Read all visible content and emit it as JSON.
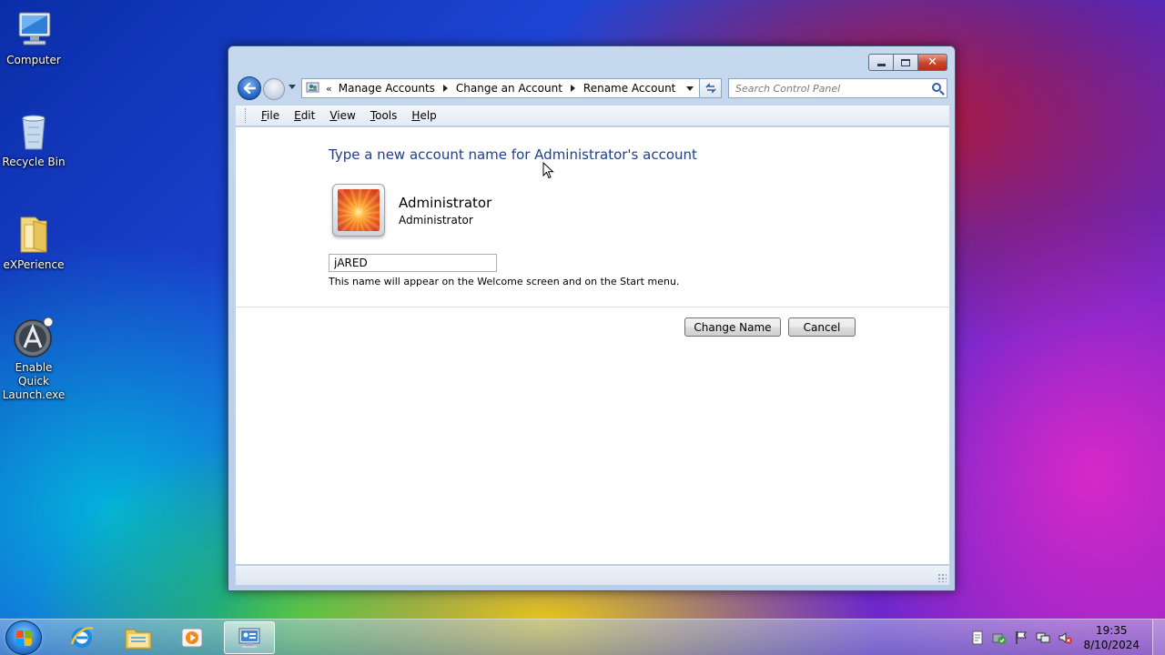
{
  "desktop": {
    "icons": [
      {
        "label": "Computer"
      },
      {
        "label": "Recycle Bin"
      },
      {
        "label": "eXPerience"
      },
      {
        "label": "Enable Quick Launch.exe"
      }
    ]
  },
  "window": {
    "breadcrumbs": [
      "Manage Accounts",
      "Change an Account",
      "Rename Account"
    ],
    "search_placeholder": "Search Control Panel",
    "menu": [
      "File",
      "Edit",
      "View",
      "Tools",
      "Help"
    ],
    "heading": "Type a new account name for Administrator's account",
    "account": {
      "name": "Administrator",
      "type": "Administrator"
    },
    "new_name_value": "jARED",
    "hint": "This name will appear on the Welcome screen and on the Start menu.",
    "buttons": {
      "change_name": "Change Name",
      "cancel": "Cancel"
    }
  },
  "taskbar": {
    "pinned": [
      "internet-explorer-icon",
      "windows-explorer-icon",
      "media-player-icon",
      "control-panel-icon"
    ],
    "clock": {
      "time": "19:35",
      "date": "8/10/2024"
    }
  },
  "colors": {
    "heading": "#1e3f8a",
    "close_button": "#c9442a"
  }
}
